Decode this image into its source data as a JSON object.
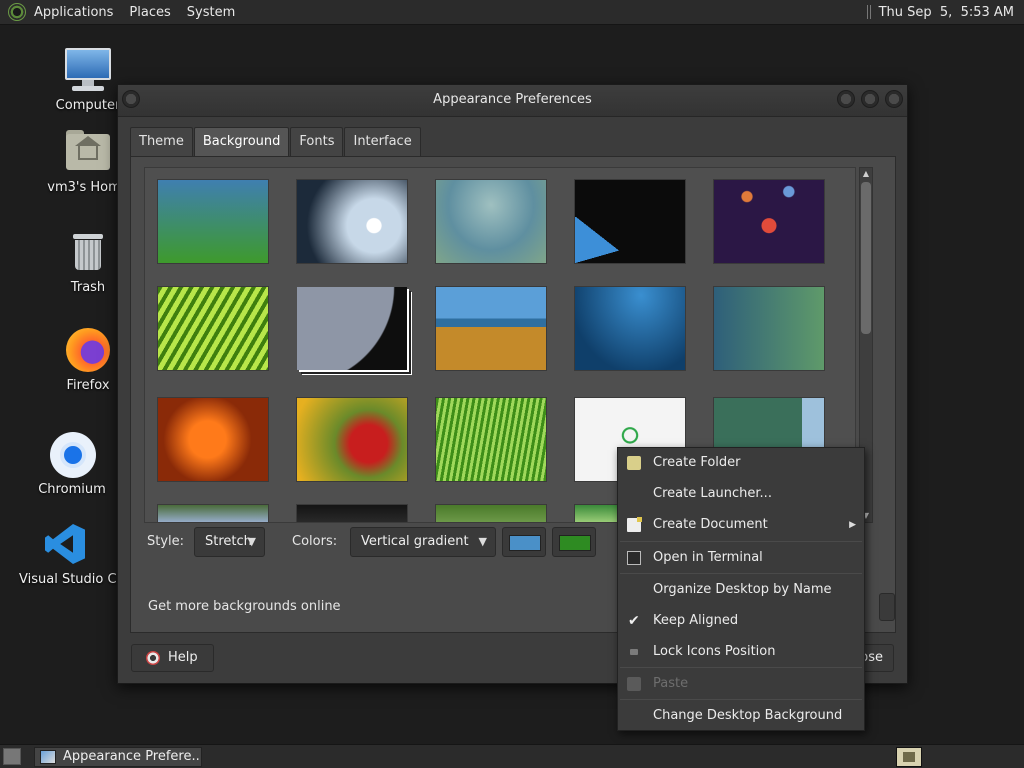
{
  "top_panel": {
    "menus": [
      "Applications",
      "Places",
      "System"
    ],
    "clock": "Thu Sep  5,  5:53 AM"
  },
  "desktop_icons": {
    "computer": "Computer",
    "home": "vm3's Home",
    "trash": "Trash",
    "firefox": "Firefox",
    "chromium": "Chromium",
    "vscode": "Visual Studio Code"
  },
  "window": {
    "title": "Appearance Preferences",
    "tabs": [
      "Theme",
      "Background",
      "Fonts",
      "Interface"
    ],
    "active_tab": "Background",
    "style_label": "Style:",
    "style_value": "Stretch",
    "colors_label": "Colors:",
    "colors_value": "Vertical gradient",
    "primary_color": "#4a90c8",
    "secondary_color": "#2e8b22",
    "online_link": "Get more backgrounds online",
    "help_label": "Help",
    "close_label": "Close"
  },
  "wallpapers": [
    {
      "style": "gradient-blue-green",
      "c1": "#3f7fb0",
      "c2": "#3e9a2c"
    },
    {
      "style": "drop",
      "c1": "#1c2a3a",
      "c2": "#c7d8e8"
    },
    {
      "style": "soft",
      "c1": "#5f8fa0",
      "c2": "#7fa58a"
    },
    {
      "style": "arch",
      "c1": "#0b0b0b",
      "c2": "#3d8fd8"
    },
    {
      "style": "space",
      "c1": "#2b1745",
      "c2": "#e14b3a"
    },
    {
      "style": "leaf",
      "c1": "#3f7f0e",
      "c2": "#b8e64a"
    },
    {
      "style": "planet",
      "c1": "#0e0e0e",
      "c2": "#8e96a6",
      "selected": true
    },
    {
      "style": "grass-sea",
      "c1": "#5b9fd8",
      "c2": "#c48a2a"
    },
    {
      "style": "bubbles",
      "c1": "#0f3f6a",
      "c2": "#3a8fd0"
    },
    {
      "style": "gradient-teal",
      "c1": "#2e5f7a",
      "c2": "#5f9a6a"
    },
    {
      "style": "flower-orange",
      "c1": "#8a2a08",
      "c2": "#ff7a1a"
    },
    {
      "style": "flower-red",
      "c1": "#e6b020",
      "c2": "#c81e1e"
    },
    {
      "style": "grass",
      "c1": "#3e8e18",
      "c2": "#9fd85a"
    },
    {
      "style": "logo",
      "c1": "#f4f4f4",
      "c2": "#2fa84a"
    },
    {
      "style": "earth",
      "c1": "#3a6f5a",
      "c2": "#9ec1dc"
    },
    {
      "style": "partial",
      "c1": "#4a6b3a",
      "c2": "#9ab0d0"
    },
    {
      "style": "partial",
      "c1": "#141414",
      "c2": "#2a2a2a"
    },
    {
      "style": "partial",
      "c1": "#4a7a2a",
      "c2": "#6e9a4a"
    },
    {
      "style": "partial",
      "c1": "#3a8a3a",
      "c2": "#9ed07a"
    },
    {
      "style": "partial",
      "c1": "#3a6a6a",
      "c2": "#6a9a8a"
    }
  ],
  "context_menu": {
    "items": [
      {
        "label": "Create Folder",
        "icon": "folder-new-icon"
      },
      {
        "label": "Create Launcher...",
        "icon": ""
      },
      {
        "label": "Create Document",
        "icon": "document-new-icon",
        "submenu": true
      },
      {
        "label": "Open in Terminal",
        "icon": "terminal-icon"
      },
      {
        "label": "Organize Desktop by Name",
        "icon": ""
      },
      {
        "label": "Keep Aligned",
        "icon": "check-icon",
        "checked": true
      },
      {
        "label": "Lock Icons Position",
        "icon": "lock-icon"
      },
      {
        "label": "Paste",
        "icon": "paste-icon",
        "disabled": true
      },
      {
        "label": "Change Desktop Background",
        "icon": ""
      }
    ]
  },
  "bottom_panel": {
    "task_label": "Appearance Prefere..."
  }
}
